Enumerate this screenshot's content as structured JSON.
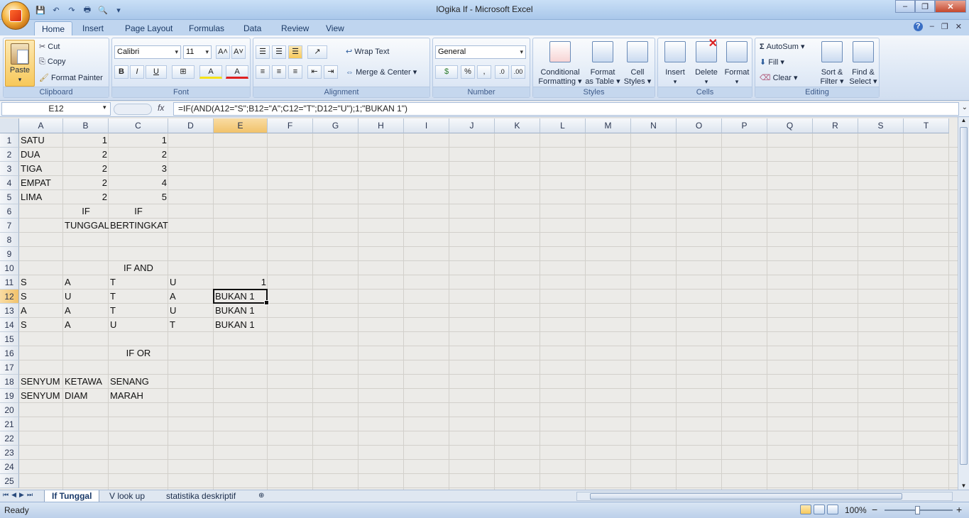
{
  "window": {
    "title": "lOgika If - Microsoft Excel",
    "min": "–",
    "max": "❐",
    "close": "✕"
  },
  "qat": {
    "save": "💾",
    "undo": "↶",
    "redo": "↷",
    "print": "🖶",
    "preview": "🔍",
    "more": "▾"
  },
  "tabs": [
    "Home",
    "Insert",
    "Page Layout",
    "Formulas",
    "Data",
    "Review",
    "View"
  ],
  "tab_right": {
    "help": "?",
    "min": "–",
    "restore": "❐",
    "close": "✕"
  },
  "ribbon": {
    "clipboard": {
      "label": "Clipboard",
      "paste": "Paste",
      "cut": "Cut",
      "copy": "Copy",
      "format_painter": "Format Painter"
    },
    "font": {
      "label": "Font",
      "name": "Calibri",
      "size": "11",
      "grow": "A˄",
      "shrink": "A˅",
      "bold": "B",
      "italic": "I",
      "underline": "U",
      "borders": "⊞",
      "fill": "A",
      "color": "A"
    },
    "alignment": {
      "label": "Alignment",
      "wrap": "Wrap Text",
      "merge": "Merge & Center"
    },
    "number": {
      "label": "Number",
      "format": "General",
      "currency": "$",
      "percent": "%",
      "comma": ",",
      "inc": ".0",
      "dec": ".00"
    },
    "styles": {
      "label": "Styles",
      "cond1": "Conditional",
      "cond2": "Formatting",
      "table1": "Format",
      "table2": "as Table",
      "cell1": "Cell",
      "cell2": "Styles"
    },
    "cells": {
      "label": "Cells",
      "insert": "Insert",
      "delete": "Delete",
      "format": "Format"
    },
    "editing": {
      "label": "Editing",
      "autosum": "AutoSum",
      "fill": "Fill",
      "clear": "Clear",
      "sort1": "Sort &",
      "sort2": "Filter",
      "find1": "Find &",
      "find2": "Select"
    }
  },
  "formula_bar": {
    "name_box": "E12",
    "fx": "fx",
    "formula": "=IF(AND(A12=\"S\";B12=\"A\";C12=\"T\";D12=\"U\");1;\"BUKAN 1\")"
  },
  "columns": [
    "A",
    "B",
    "C",
    "D",
    "E",
    "F",
    "G",
    "H",
    "I",
    "J",
    "K",
    "L",
    "M",
    "N",
    "O",
    "P",
    "Q",
    "R",
    "S",
    "T"
  ],
  "rows": [
    "1",
    "2",
    "3",
    "4",
    "5",
    "6",
    "7",
    "8",
    "9",
    "10",
    "11",
    "12",
    "13",
    "14",
    "15",
    "16",
    "17",
    "18",
    "19",
    "20",
    "21",
    "22",
    "23",
    "24",
    "25"
  ],
  "cells": [
    {
      "ref": "A1",
      "v": "SATU"
    },
    {
      "ref": "B1",
      "v": "1"
    },
    {
      "ref": "C1",
      "v": "1"
    },
    {
      "ref": "A2",
      "v": "DUA"
    },
    {
      "ref": "B2",
      "v": "2"
    },
    {
      "ref": "C2",
      "v": "2"
    },
    {
      "ref": "A3",
      "v": "TIGA"
    },
    {
      "ref": "B3",
      "v": "2"
    },
    {
      "ref": "C3",
      "v": "3"
    },
    {
      "ref": "A4",
      "v": "EMPAT"
    },
    {
      "ref": "B4",
      "v": "2"
    },
    {
      "ref": "C4",
      "v": "4"
    },
    {
      "ref": "A5",
      "v": "LIMA"
    },
    {
      "ref": "B5",
      "v": "2"
    },
    {
      "ref": "C5",
      "v": "5"
    },
    {
      "ref": "B6",
      "v": "IF"
    },
    {
      "ref": "C6",
      "v": "IF"
    },
    {
      "ref": "B7",
      "v": "TUNGGAL"
    },
    {
      "ref": "C7",
      "v": "BERTINGKAT"
    },
    {
      "ref": "C10",
      "v": "IF AND"
    },
    {
      "ref": "A11",
      "v": "S"
    },
    {
      "ref": "B11",
      "v": "A"
    },
    {
      "ref": "C11",
      "v": "T"
    },
    {
      "ref": "D11",
      "v": "U"
    },
    {
      "ref": "E11",
      "v": "1"
    },
    {
      "ref": "A12",
      "v": "S"
    },
    {
      "ref": "B12",
      "v": "U"
    },
    {
      "ref": "C12",
      "v": "T"
    },
    {
      "ref": "D12",
      "v": "A"
    },
    {
      "ref": "E12",
      "v": "BUKAN 1"
    },
    {
      "ref": "A13",
      "v": "A"
    },
    {
      "ref": "B13",
      "v": "A"
    },
    {
      "ref": "C13",
      "v": "T"
    },
    {
      "ref": "D13",
      "v": "U"
    },
    {
      "ref": "E13",
      "v": "BUKAN 1"
    },
    {
      "ref": "A14",
      "v": "S"
    },
    {
      "ref": "B14",
      "v": "A"
    },
    {
      "ref": "C14",
      "v": "U"
    },
    {
      "ref": "D14",
      "v": "T"
    },
    {
      "ref": "E14",
      "v": "BUKAN 1"
    },
    {
      "ref": "C16",
      "v": "IF OR"
    },
    {
      "ref": "A18",
      "v": "SENYUM"
    },
    {
      "ref": "B18",
      "v": "KETAWA"
    },
    {
      "ref": "C18",
      "v": "SENANG"
    },
    {
      "ref": "A19",
      "v": "SENYUM"
    },
    {
      "ref": "B19",
      "v": "DIAM"
    },
    {
      "ref": "C19",
      "v": "MARAH"
    }
  ],
  "selected": "E12",
  "sheets": [
    "If Tunggal",
    "V look up",
    "statistika deskriptif"
  ],
  "sheet_nav": [
    "⏮",
    "◀",
    "▶",
    "⏭"
  ],
  "status": {
    "ready": "Ready",
    "zoom": "100%",
    "minus": "−",
    "plus": "+"
  }
}
